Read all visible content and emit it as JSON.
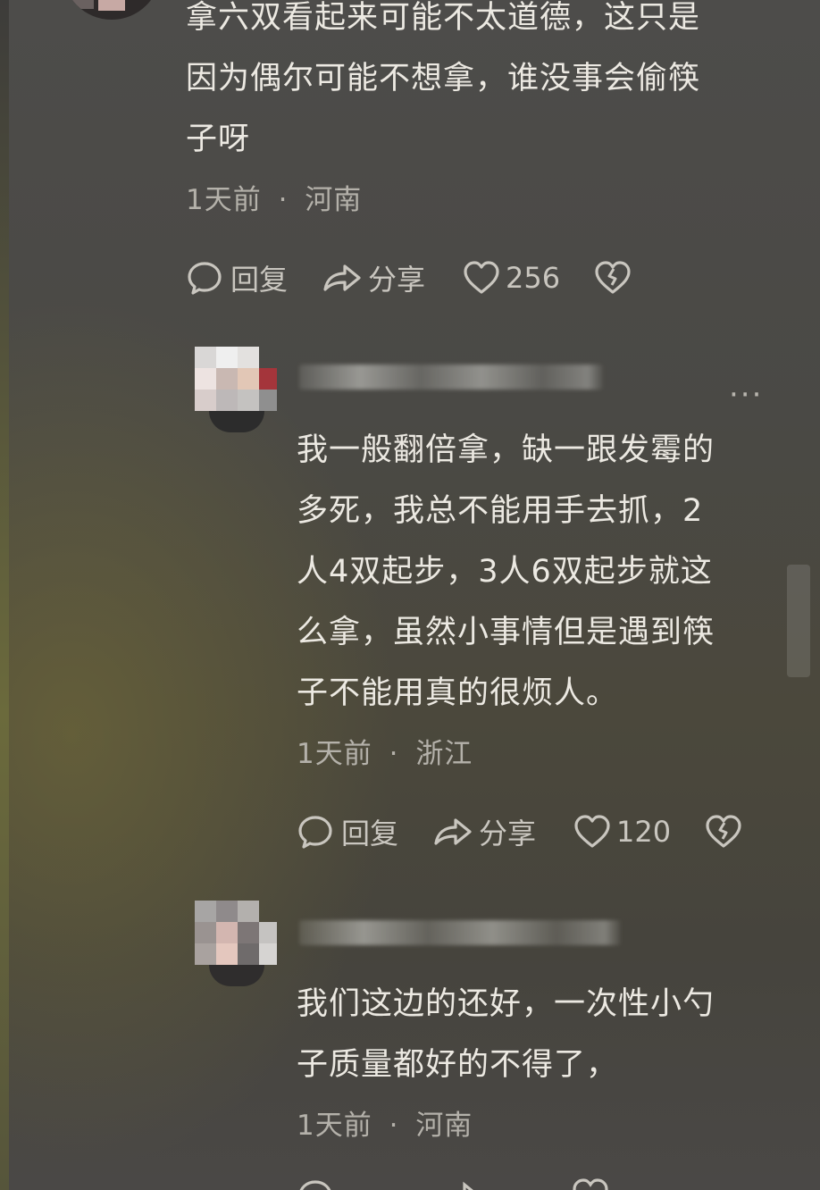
{
  "comments": [
    {
      "lines": [
        "拿六双看起来可能不太道德，这只是",
        "因为偶尔可能不想拿，谁没事会偷筷",
        "子呀"
      ],
      "time": "1天前",
      "sep": "·",
      "location": "河南",
      "reply_label": "回复",
      "share_label": "分享",
      "likes": "256"
    },
    {
      "lines": [
        "我一般翻倍拿，缺一跟发霉的",
        "多死，我总不能用手去抓，2",
        "人4双起步，3人6双起步就这",
        "么拿，虽然小事情但是遇到筷",
        "子不能用真的很烦人。"
      ],
      "time": "1天前",
      "sep": "·",
      "location": "浙江",
      "reply_label": "回复",
      "share_label": "分享",
      "likes": "120",
      "more": "···"
    },
    {
      "lines": [
        "我们这边的还好，一次性小勺",
        "子质量都好的不得了，"
      ],
      "time": "1天前",
      "sep": "·",
      "location": "河南"
    }
  ],
  "icons": {
    "reply": "comment-bubble-icon",
    "share": "share-arrow-icon",
    "like": "heart-icon",
    "dislike": "broken-heart-icon",
    "more": "more-dots-icon"
  },
  "colors": {
    "text": "#ece9e2",
    "meta": "#b4b1aa",
    "icon": "#c9c6bf"
  }
}
